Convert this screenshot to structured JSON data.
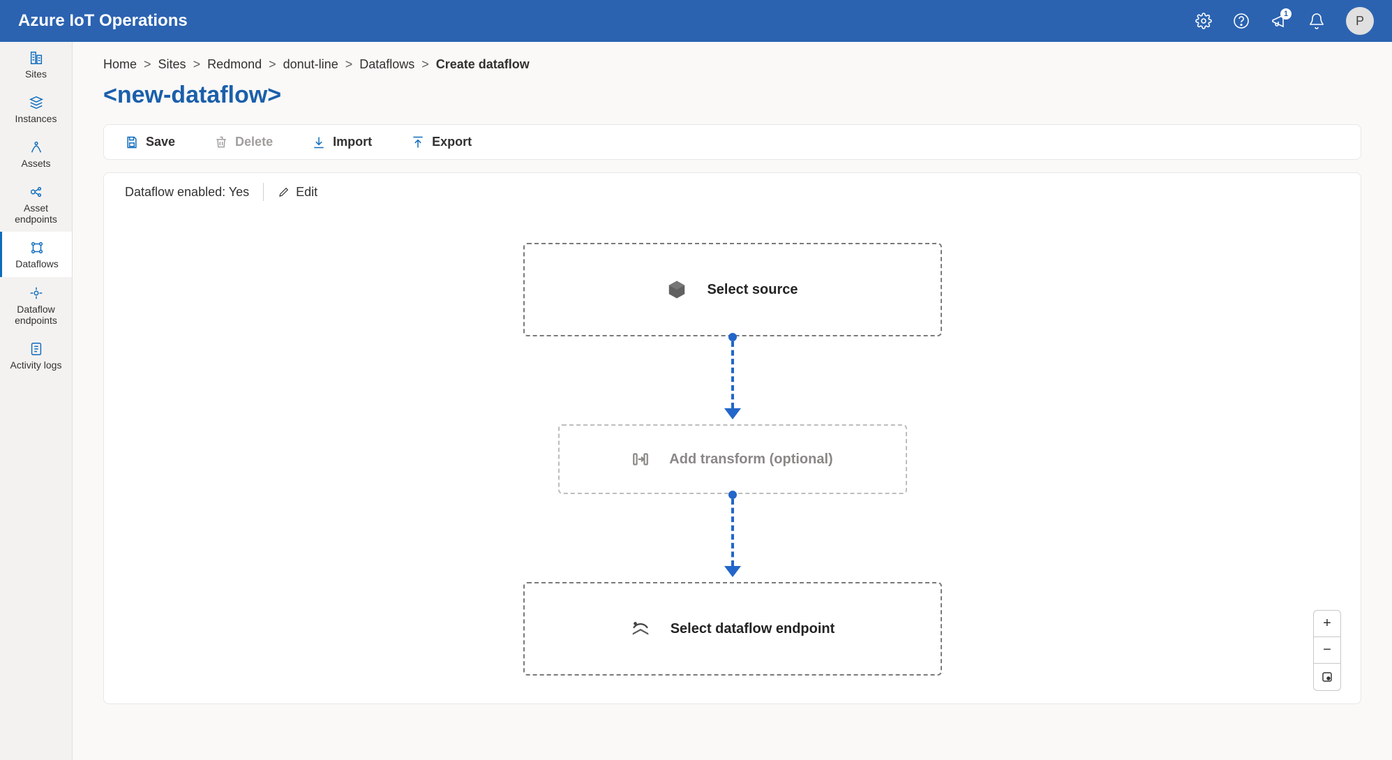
{
  "header": {
    "title": "Azure IoT Operations",
    "notification_badge": "1",
    "avatar_initial": "P"
  },
  "sidebar": {
    "items": [
      {
        "label": "Sites"
      },
      {
        "label": "Instances"
      },
      {
        "label": "Assets"
      },
      {
        "label": "Asset endpoints"
      },
      {
        "label": "Dataflows"
      },
      {
        "label": "Dataflow endpoints"
      },
      {
        "label": "Activity logs"
      }
    ]
  },
  "breadcrumb": {
    "items": [
      "Home",
      "Sites",
      "Redmond",
      "donut-line",
      "Dataflows"
    ],
    "current": "Create dataflow"
  },
  "page": {
    "title": "<new-dataflow>"
  },
  "toolbar": {
    "save": "Save",
    "delete": "Delete",
    "import": "Import",
    "export": "Export"
  },
  "canvas": {
    "enabled_label": "Dataflow enabled: Yes",
    "edit": "Edit",
    "nodes": {
      "source": "Select source",
      "transform": "Add transform (optional)",
      "endpoint": "Select dataflow endpoint"
    }
  },
  "zoom": {
    "in": "+",
    "out": "−"
  }
}
